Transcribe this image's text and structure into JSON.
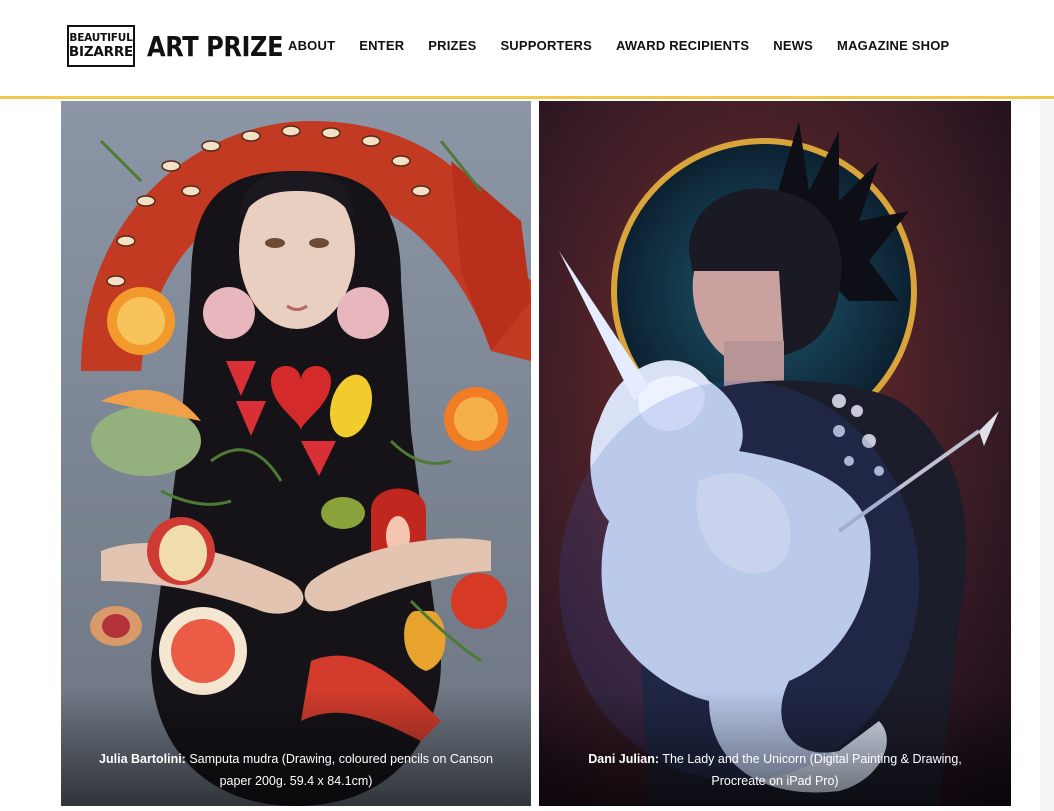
{
  "brand": {
    "logo_line1": "BEAUTIFUL",
    "logo_line2": "BIZARRE",
    "title": "ART PRIZE"
  },
  "nav": [
    {
      "label": "ABOUT"
    },
    {
      "label": "ENTER"
    },
    {
      "label": "PRIZES"
    },
    {
      "label": "SUPPORTERS"
    },
    {
      "label": "AWARD RECIPIENTS"
    },
    {
      "label": "NEWS"
    },
    {
      "label": "MAGAZINE SHOP"
    }
  ],
  "gallery": [
    {
      "artist": "Julia Bartolini:",
      "details": " Samputa mudra (Drawing, coloured pencils on Canson paper 200g. 59.4 x 84.1cm)"
    },
    {
      "artist": "Dani Julian:",
      "details": " The Lady and the Unicorn (Digital Painting & Drawing, Procreate on iPad Pro)"
    }
  ],
  "colors": {
    "accent_border": "#f2c94c",
    "text": "#111111"
  }
}
